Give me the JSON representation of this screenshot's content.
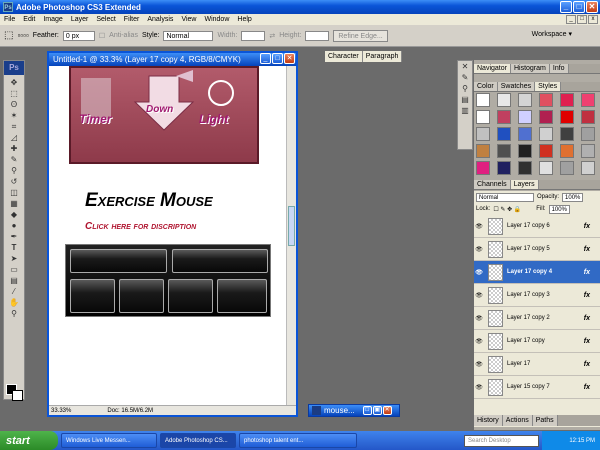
{
  "window": {
    "title": "Adobe Photoshop CS3 Extended"
  },
  "menu": [
    "File",
    "Edit",
    "Image",
    "Layer",
    "Select",
    "Filter",
    "Analysis",
    "View",
    "Window",
    "Help"
  ],
  "options": {
    "feather_label": "Feather:",
    "feather_value": "0 px",
    "antialias_label": "Anti-alias",
    "style_label": "Style:",
    "style_value": "Normal",
    "width_label": "Width:",
    "height_label": "Height:",
    "refine_edge": "Refine Edge...",
    "workspace": "Workspace"
  },
  "document": {
    "title": "Untitled-1 @ 33.3% (Layer 17 copy 4, RGB/8/CMYK)",
    "zoom": "33.33%",
    "doc_info": "Doc: 16.5M/6.2M",
    "banner_labels": [
      "Timer",
      "Down",
      "Light"
    ],
    "heading": "Exercise Mouse",
    "subheading": "Click here for discription"
  },
  "minimized_doc": {
    "title": "mouse..."
  },
  "char_tabs": [
    "Character",
    "Paragraph"
  ],
  "nav_tabs": [
    "Navigator",
    "Histogram",
    "Info"
  ],
  "style_tabs": [
    "Color",
    "Swatches",
    "Styles"
  ],
  "layer_tabs": [
    "Channels",
    "Layers"
  ],
  "layers_panel": {
    "blend_mode": "Normal",
    "opacity_label": "Opacity:",
    "opacity_value": "100%",
    "lock_label": "Lock:",
    "fill_label": "Fill:",
    "fill_value": "100%",
    "rows": [
      {
        "name": "Layer 17 copy 6",
        "selected": false
      },
      {
        "name": "Layer 17 copy 5",
        "selected": false
      },
      {
        "name": "Layer 17 copy 4",
        "selected": true
      },
      {
        "name": "Layer 17 copy 3",
        "selected": false
      },
      {
        "name": "Layer 17 copy 2",
        "selected": false
      },
      {
        "name": "Layer 17 copy",
        "selected": false
      },
      {
        "name": "Layer 17",
        "selected": false
      },
      {
        "name": "Layer 15 copy 7",
        "selected": false
      }
    ],
    "fx_label": "fx"
  },
  "history_tabs": [
    "History",
    "Actions",
    "Paths"
  ],
  "taskbar": {
    "start": "start",
    "tasks": [
      "Windows Live Messen...",
      "Adobe Photoshop CS...",
      "photoshop talent ent..."
    ],
    "search": "Search Desktop",
    "clock": "12:15 PM"
  },
  "style_swatches": [
    "#ffffff",
    "#e8e8e8",
    "#d4d4d4",
    "#e05060",
    "#e02050",
    "#f04070",
    "#ffffff",
    "#c04060",
    "#d0d0ff",
    "#b02050",
    "#e00000",
    "#c03040",
    "#c0c0c0",
    "#2050c0",
    "#5070d0",
    "#d0d0d0",
    "#404040",
    "#a0a0a0",
    "#c08040",
    "#505050",
    "#202020",
    "#d03020",
    "#e07030",
    "#b0b0b0",
    "#e02080",
    "#202060",
    "#303030",
    "#e0e0e0",
    "#a0a0a0",
    "#d0d0d0"
  ]
}
